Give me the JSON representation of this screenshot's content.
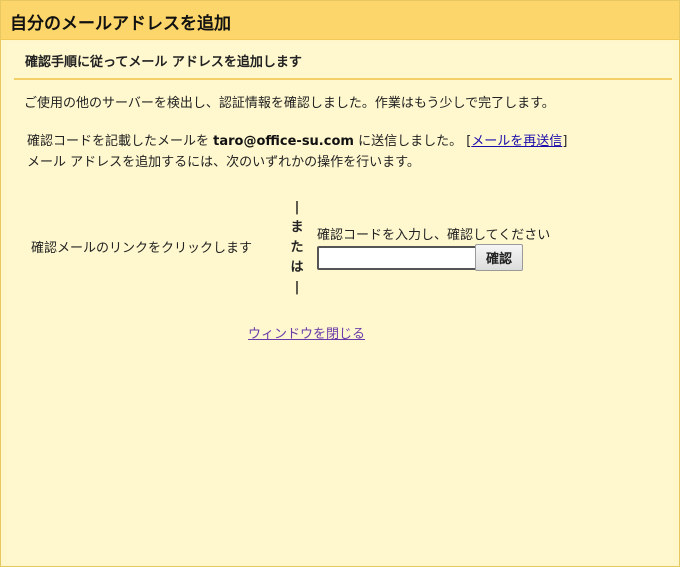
{
  "dialog": {
    "title": "自分のメールアドレスを追加",
    "step_heading": "確認手順に従ってメール アドレスを追加します",
    "verified_message": "ご使用の他のサーバーを検出し、認証情報を確認しました。作業はもう少しで完了します。",
    "sent_prefix": "確認コードを記載したメールを ",
    "email": "taro@office-su.com",
    "sent_suffix": " に送信しました。",
    "resend_open": "[",
    "resend_label": "メールを再送信",
    "resend_close": "]",
    "instruction": "メール アドレスを追加するには、次のいずれかの操作を行います。",
    "option_link_text": "確認メールのリンクをクリックします",
    "or_lines": [
      "|",
      "ま",
      "た",
      "は",
      "|"
    ],
    "option_code_label": "確認コードを入力し、確認してください",
    "code_input_value": "",
    "confirm_label": "確認",
    "close_window_label": "ウィンドウを閉じる"
  },
  "colors": {
    "title_bar": "#fcd66a",
    "panel_bg": "#fff8cf",
    "rule": "#f3cf68",
    "link": "#1a0dab",
    "visited_link": "#6a3aa8"
  }
}
